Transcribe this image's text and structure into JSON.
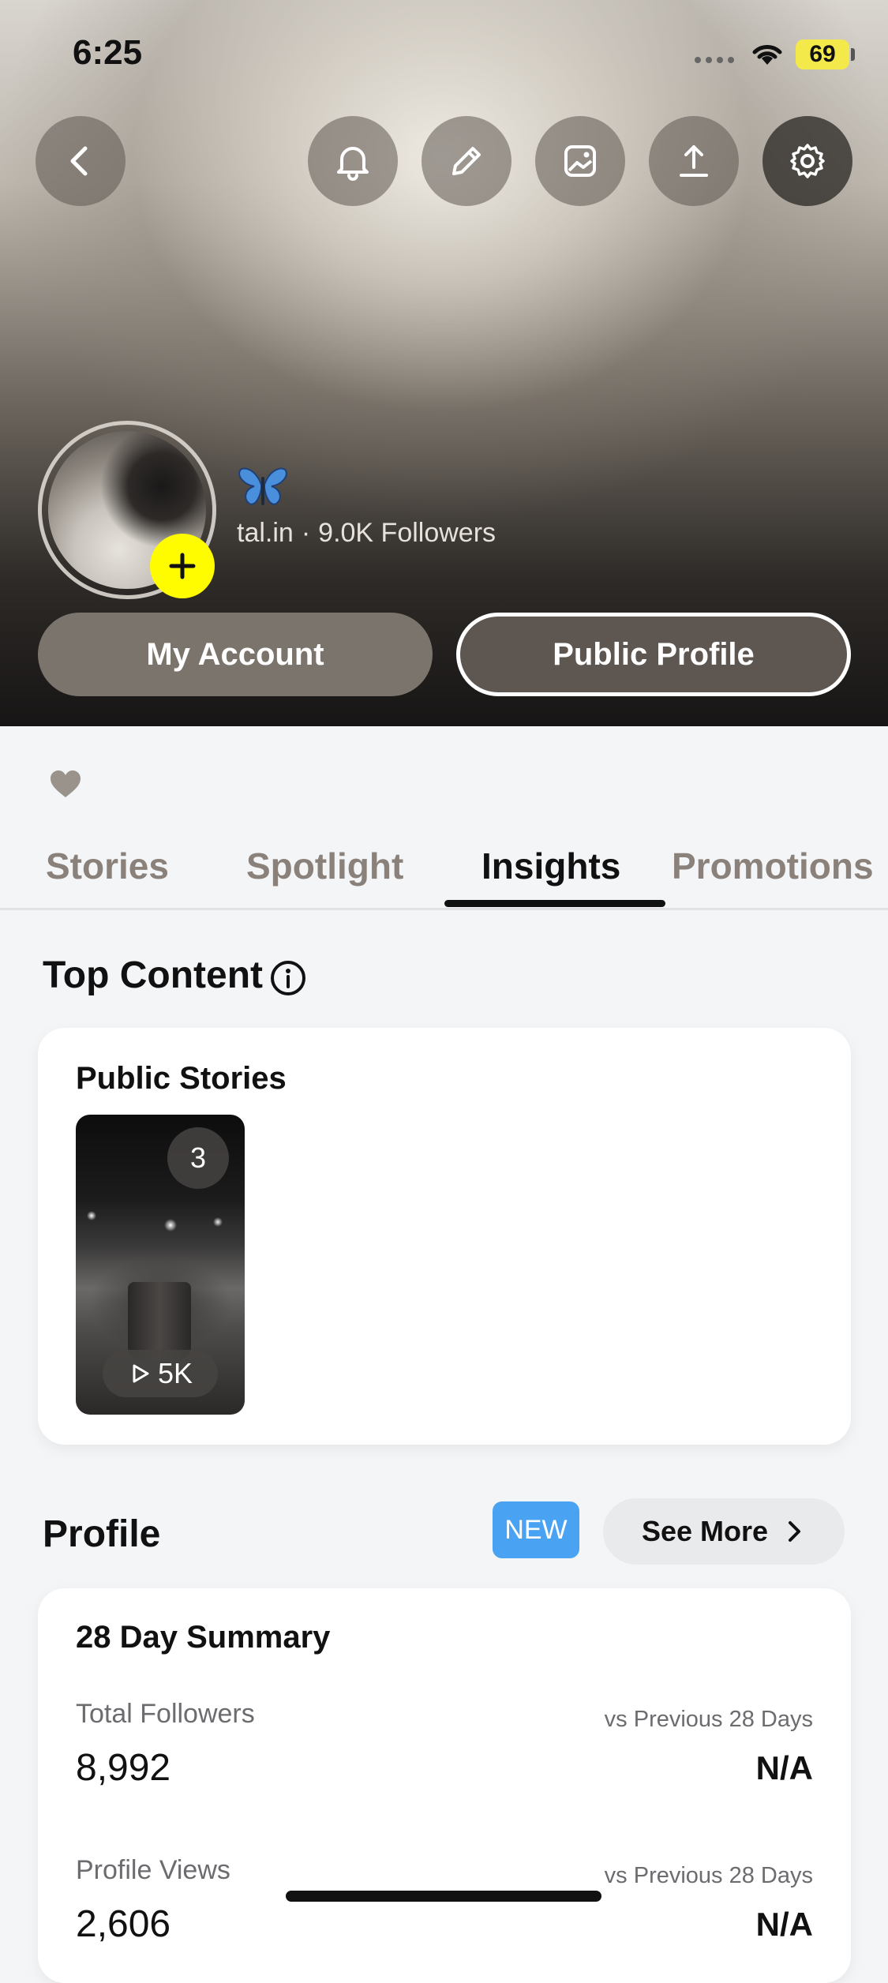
{
  "status_bar": {
    "time": "6:25",
    "battery": "69",
    "battery_color": "#f4e94a"
  },
  "header": {
    "icons": [
      "back-icon",
      "bell-icon",
      "pencil-icon",
      "image-icon",
      "share-icon",
      "gear-icon"
    ],
    "profile": {
      "emoji": "🦋",
      "username": "tal.in",
      "separator": "·",
      "followers": "9.0K Followers"
    },
    "buttons": {
      "my_account": "My Account",
      "public_profile": "Public Profile"
    }
  },
  "bio_emoji": "🩶",
  "tabs": [
    {
      "label": "Stories",
      "active": false
    },
    {
      "label": "Spotlight",
      "active": false
    },
    {
      "label": "Insights",
      "active": true
    },
    {
      "label": "Promotions",
      "active": false
    }
  ],
  "top_content": {
    "title": "Top Content",
    "card": {
      "title": "Public Stories",
      "story": {
        "count": "3",
        "views": "5K"
      }
    }
  },
  "profile_section": {
    "title": "Profile",
    "badge": "NEW",
    "see_more": "See More",
    "badge_color": "#4aa3f2",
    "summary": {
      "title": "28 Day Summary",
      "stats": [
        {
          "label": "Total Followers",
          "value": "8,992",
          "compare_label": "vs Previous 28 Days",
          "change": "N/A"
        },
        {
          "label": "Profile Views",
          "value": "2,606",
          "compare_label": "vs Previous 28 Days",
          "change": "N/A"
        }
      ]
    }
  },
  "colors": {
    "accent_yellow": "#fffc00",
    "tab_inactive": "#8a817a",
    "text_primary": "#111111"
  }
}
